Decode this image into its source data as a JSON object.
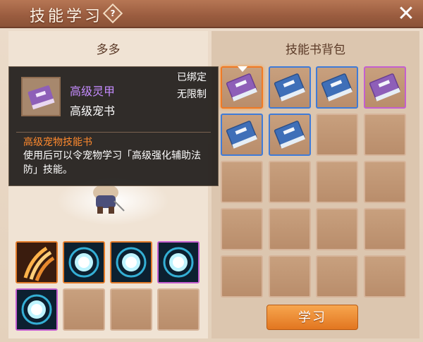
{
  "window": {
    "title": "技能学习",
    "help_glyph": "?",
    "close_glyph": "✕"
  },
  "left_panel": {
    "pet_name": "多多"
  },
  "right_panel": {
    "title": "技能书背包"
  },
  "tooltip": {
    "item_name": "高级灵甲",
    "item_type": "高级宠书",
    "bind_status": "已绑定",
    "limit_status": "无限制",
    "category": "高级宠物技能书",
    "description": "使用后可以令宠物学习「高级强化辅助法防」技能。"
  },
  "pet_skill_slots": [
    {
      "state": "skill",
      "icon": "claw-skill-icon",
      "frame": "orange"
    },
    {
      "state": "skill",
      "icon": "blue-orb-skill-icon",
      "frame": "orange"
    },
    {
      "state": "skill",
      "icon": "blue-orb-skill-icon",
      "frame": "orange"
    },
    {
      "state": "skill",
      "icon": "blue-orb-skill-icon",
      "frame": "purple"
    },
    {
      "state": "skill",
      "icon": "blue-orb-skill-icon",
      "frame": "purple"
    },
    {
      "state": "empty"
    },
    {
      "state": "empty"
    },
    {
      "state": "empty"
    }
  ],
  "book_slots": [
    {
      "state": "book",
      "color": "purple",
      "selected": true
    },
    {
      "state": "book",
      "color": "blue"
    },
    {
      "state": "book",
      "color": "blue"
    },
    {
      "state": "book",
      "color": "purple"
    },
    {
      "state": "book",
      "color": "blue"
    },
    {
      "state": "book",
      "color": "blue"
    },
    {
      "state": "empty"
    },
    {
      "state": "empty"
    },
    {
      "state": "empty"
    },
    {
      "state": "empty"
    },
    {
      "state": "empty"
    },
    {
      "state": "empty"
    },
    {
      "state": "empty"
    },
    {
      "state": "empty"
    },
    {
      "state": "empty"
    },
    {
      "state": "empty"
    },
    {
      "state": "empty"
    },
    {
      "state": "empty"
    },
    {
      "state": "empty"
    },
    {
      "state": "empty"
    }
  ],
  "actions": {
    "learn_label": "学习"
  },
  "colors": {
    "accent": "#e27620",
    "purple_item": "#c58cff",
    "category": "#ff8a2e"
  }
}
